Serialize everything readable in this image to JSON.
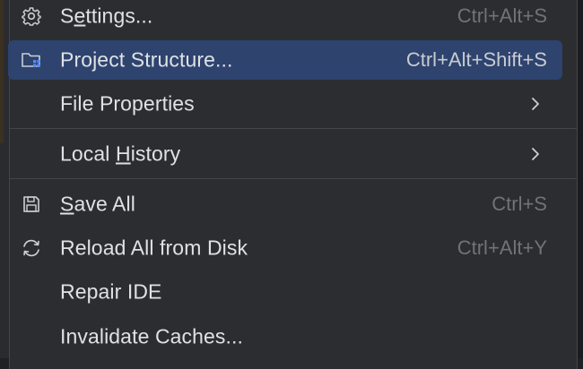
{
  "menu": {
    "items": [
      {
        "id": "settings",
        "pre": "S",
        "mn": "e",
        "post": "ttings...",
        "shortcut": "Ctrl+Alt+S",
        "icon": "gear-icon"
      },
      {
        "id": "project-structure",
        "pre": "Project Structure...",
        "mn": "",
        "post": "",
        "shortcut": "Ctrl+Alt+Shift+S",
        "icon": "project-structure-icon",
        "highlighted": true
      },
      {
        "id": "file-properties",
        "pre": "File Properties",
        "mn": "",
        "post": "",
        "shortcut": "",
        "submenu": true
      },
      {
        "id": "local-history",
        "pre": "Local ",
        "mn": "H",
        "post": "istory",
        "shortcut": "",
        "submenu": true
      },
      {
        "id": "save-all",
        "pre": "",
        "mn": "S",
        "post": "ave All",
        "shortcut": "Ctrl+S",
        "icon": "save-icon"
      },
      {
        "id": "reload-all",
        "pre": "Reload All from Disk",
        "mn": "",
        "post": "",
        "shortcut": "Ctrl+Alt+Y",
        "icon": "reload-icon"
      },
      {
        "id": "repair-ide",
        "pre": "Repair IDE",
        "mn": "",
        "post": "",
        "shortcut": ""
      },
      {
        "id": "invalidate-caches",
        "pre": "Invalidate Caches...",
        "mn": "",
        "post": "",
        "shortcut": ""
      }
    ]
  },
  "colors": {
    "highlight": "#2e436e",
    "text": "#dfe1e5",
    "shortcut": "#6f737a",
    "separator": "#43454a"
  }
}
